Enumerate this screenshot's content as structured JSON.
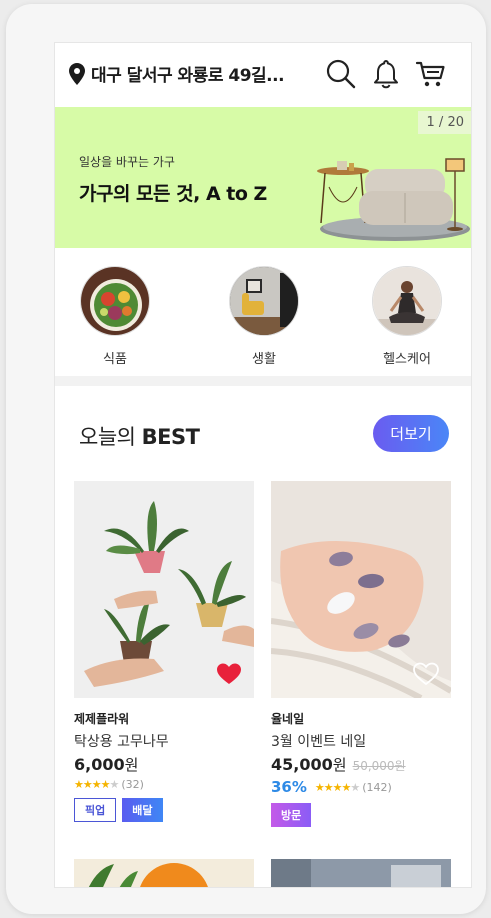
{
  "header": {
    "location": "대구 달서구 와룡로 49길...",
    "icons": [
      "location-pin-icon",
      "search-icon",
      "bell-icon",
      "cart-icon"
    ]
  },
  "banner": {
    "counter": "1 / 20",
    "subtitle": "일상을 바꾸는 가구",
    "title": "가구의 모든 것, A to Z",
    "background": "#d7fba7"
  },
  "categories": [
    {
      "label": "식품"
    },
    {
      "label": "생활"
    },
    {
      "label": "헬스케어"
    }
  ],
  "best": {
    "title_normal": "오늘의 ",
    "title_bold": "BEST",
    "more_label": "더보기",
    "products": [
      {
        "brand": "제제플라워",
        "name": "탁상용 고무나무",
        "price": "6,000",
        "currency": "원",
        "original_price": "",
        "discount": "",
        "rating": 4,
        "review_count": "(32)",
        "liked": true,
        "tags": [
          "픽업",
          "배달"
        ]
      },
      {
        "brand": "율네일",
        "name": "3월 이벤트 네일",
        "price": "45,000",
        "currency": "원",
        "original_price": "50,000원",
        "discount": "36%",
        "rating": 4,
        "review_count": "(142)",
        "liked": false,
        "tags": [
          "방문"
        ]
      }
    ]
  },
  "colors": {
    "accent": "#5b6cf2",
    "heart": "#e8213b",
    "discount": "#2e8ae6",
    "star": "#f5b400"
  }
}
